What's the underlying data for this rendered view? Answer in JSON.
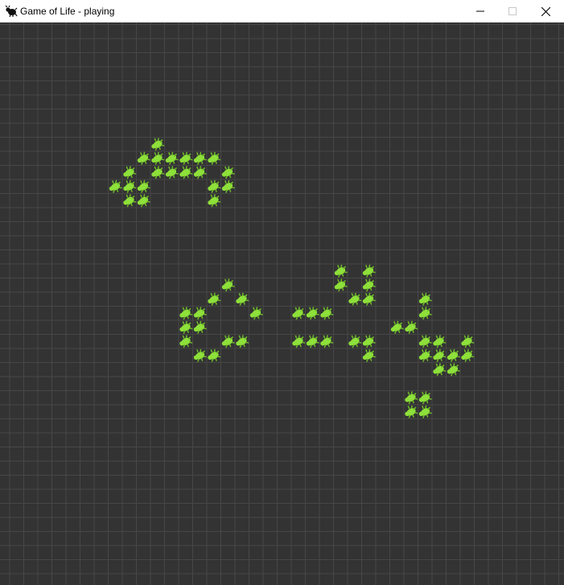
{
  "window": {
    "title": "Game of Life - playing",
    "icon": "bug-icon"
  },
  "controls": {
    "minimize": "minimize-icon",
    "maximize": "maximize-icon",
    "close": "close-icon"
  },
  "colors": {
    "background": "#333333",
    "grid_line": "#474747",
    "cell_alive": "#8ee03a",
    "cell_shade": "#6db82a"
  },
  "board": {
    "state": "playing",
    "cell_icon": "bug-icon",
    "alive_cells": [
      [
        11,
        8
      ],
      [
        10,
        9
      ],
      [
        11,
        9
      ],
      [
        12,
        9
      ],
      [
        13,
        9
      ],
      [
        14,
        9
      ],
      [
        15,
        9
      ],
      [
        9,
        10
      ],
      [
        11,
        10
      ],
      [
        12,
        10
      ],
      [
        13,
        10
      ],
      [
        14,
        10
      ],
      [
        16,
        10
      ],
      [
        8,
        11
      ],
      [
        9,
        11
      ],
      [
        10,
        11
      ],
      [
        15,
        11
      ],
      [
        16,
        11
      ],
      [
        9,
        12
      ],
      [
        10,
        12
      ],
      [
        15,
        12
      ],
      [
        16,
        18
      ],
      [
        15,
        19
      ],
      [
        17,
        19
      ],
      [
        13,
        20
      ],
      [
        14,
        20
      ],
      [
        18,
        20
      ],
      [
        13,
        21
      ],
      [
        14,
        21
      ],
      [
        13,
        22
      ],
      [
        16,
        22
      ],
      [
        17,
        22
      ],
      [
        14,
        23
      ],
      [
        15,
        23
      ],
      [
        24,
        17
      ],
      [
        26,
        17
      ],
      [
        24,
        18
      ],
      [
        26,
        18
      ],
      [
        25,
        19
      ],
      [
        26,
        19
      ],
      [
        21,
        20
      ],
      [
        22,
        20
      ],
      [
        23,
        20
      ],
      [
        30,
        19
      ],
      [
        28,
        21
      ],
      [
        29,
        21
      ],
      [
        30,
        20
      ],
      [
        21,
        22
      ],
      [
        22,
        22
      ],
      [
        23,
        22
      ],
      [
        25,
        22
      ],
      [
        26,
        22
      ],
      [
        26,
        23
      ],
      [
        30,
        22
      ],
      [
        31,
        22
      ],
      [
        33,
        22
      ],
      [
        30,
        23
      ],
      [
        31,
        23
      ],
      [
        32,
        23
      ],
      [
        33,
        23
      ],
      [
        31,
        24
      ],
      [
        32,
        24
      ],
      [
        29,
        26
      ],
      [
        30,
        26
      ],
      [
        29,
        27
      ],
      [
        30,
        27
      ]
    ]
  }
}
